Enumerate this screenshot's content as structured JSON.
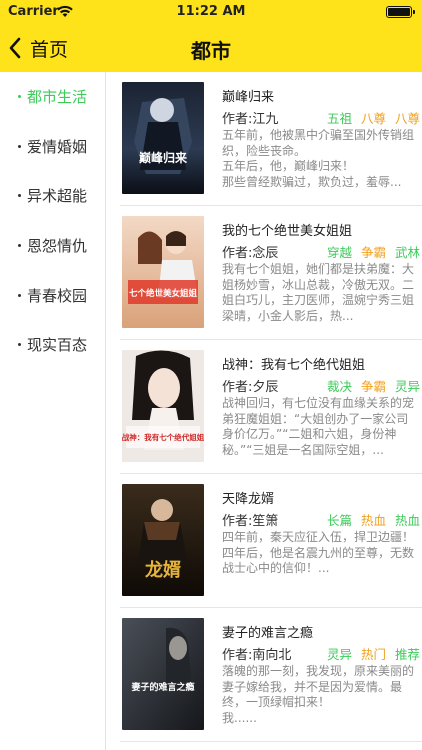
{
  "status_bar": {
    "carrier": "Carrier",
    "time": "11:22 AM"
  },
  "nav": {
    "back_label": "首页",
    "title": "都市"
  },
  "colors": {
    "header_bg": "#FFE31A",
    "active_green": "#3DCB5A",
    "tag_orange": "#F0A020"
  },
  "sidebar": {
    "items": [
      {
        "label": "都市生活",
        "active": true
      },
      {
        "label": "爱情婚姻",
        "active": false
      },
      {
        "label": "异术超能",
        "active": false
      },
      {
        "label": "恩怨情仇",
        "active": false
      },
      {
        "label": "青春校园",
        "active": false
      },
      {
        "label": "现实百态",
        "active": false
      }
    ]
  },
  "books": [
    {
      "title": "巅峰归来",
      "author": "作者:江九",
      "tags": [
        {
          "text": "五祖",
          "color": "green"
        },
        {
          "text": "八尊",
          "color": "orange"
        },
        {
          "text": "八尊",
          "color": "orange"
        }
      ],
      "desc": "五年前，他被黑中介骗至国外传销组织，险些丧命。\n五年后，他，巅峰归来！\n那些曾经欺骗过，欺负过，羞辱...",
      "cover_text": "巅峰归来"
    },
    {
      "title": "我的七个绝世美女姐姐",
      "author": "作者:念辰",
      "tags": [
        {
          "text": "穿越",
          "color": "green"
        },
        {
          "text": "争霸",
          "color": "orange"
        },
        {
          "text": "武林",
          "color": "green"
        }
      ],
      "desc": "我有七个姐姐，她们都是扶弟魔：大姐杨妙雪，冰山总裁，冷傲无双。二姐白巧儿，主刀医师，温婉宁秀三姐梁晴，小金人影后，热...",
      "cover_text": "七个绝世美女姐姐"
    },
    {
      "title": "战神：我有七个绝代姐姐",
      "author": "作者:夕辰",
      "tags": [
        {
          "text": "裁决",
          "color": "green"
        },
        {
          "text": "争霸",
          "color": "orange"
        },
        {
          "text": "灵异",
          "color": "green"
        }
      ],
      "desc": "战神回归，有七位没有血缘关系的宠弟狂魔姐姐：“大姐创办了一家公司身价亿万。”“二姐和六姐，身份神秘。”“三姐是一名国际空姐，...",
      "cover_text": "战神：我有七个绝代姐姐"
    },
    {
      "title": "天降龙婿",
      "author": "作者:笙箫",
      "tags": [
        {
          "text": "长篇",
          "color": "green"
        },
        {
          "text": "热血",
          "color": "orange"
        },
        {
          "text": "热血",
          "color": "green"
        }
      ],
      "desc": "四年前，秦天应征入伍，捍卫边疆！\n四年后，他是名震九州的至尊，无数战士心中的信仰！...",
      "cover_text": "龙婿"
    },
    {
      "title": "妻子的难言之瘾",
      "author": "作者:南向北",
      "tags": [
        {
          "text": "灵异",
          "color": "green"
        },
        {
          "text": "热门",
          "color": "orange"
        },
        {
          "text": "推荐",
          "color": "green"
        }
      ],
      "desc": "落魄的那一刻，我发现，原来美丽的妻子嫁给我，并不是因为爱情。最终，一顶绿帽扣来！\n  我......",
      "cover_text": "妻子的难言之瘾"
    }
  ]
}
